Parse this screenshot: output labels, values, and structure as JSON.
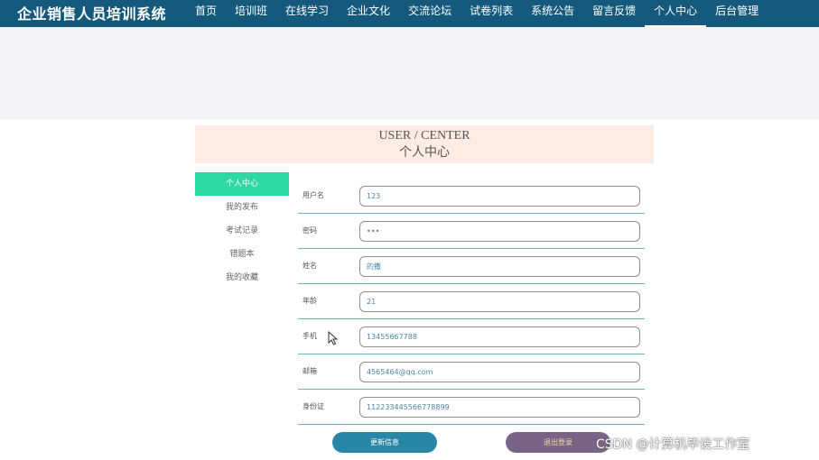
{
  "app": {
    "title": "企业销售人员培训系统"
  },
  "nav": {
    "items": [
      {
        "label": "首页"
      },
      {
        "label": "培训班"
      },
      {
        "label": "在线学习"
      },
      {
        "label": "企业文化"
      },
      {
        "label": "交流论坛"
      },
      {
        "label": "试卷列表"
      },
      {
        "label": "系统公告"
      },
      {
        "label": "留言反馈"
      },
      {
        "label": "个人中心"
      },
      {
        "label": "后台管理"
      }
    ],
    "active_index": 8
  },
  "header": {
    "title_en": "USER / CENTER",
    "title_cn": "个人中心"
  },
  "sidebar": {
    "items": [
      {
        "label": "个人中心"
      },
      {
        "label": "我的发布"
      },
      {
        "label": "考试记录"
      },
      {
        "label": "错题本"
      },
      {
        "label": "我的收藏"
      }
    ],
    "active_index": 0
  },
  "form": {
    "fields": [
      {
        "label": "用户名",
        "value": "123"
      },
      {
        "label": "密码",
        "value": "•••"
      },
      {
        "label": "姓名",
        "value": "的撒"
      },
      {
        "label": "年龄",
        "value": "21"
      },
      {
        "label": "手机",
        "value": "13455667788"
      },
      {
        "label": "邮箱",
        "value": "4565464@qq.com"
      },
      {
        "label": "身份证",
        "value": "112233445566778899"
      }
    ]
  },
  "actions": {
    "update_label": "更新信息",
    "logout_label": "退出登录"
  },
  "watermark": {
    "text": "CSDN @计算机毕设工作室"
  },
  "colors": {
    "topbar": "#155a7c",
    "sidebar_active": "#2ed8a2",
    "update_button": "#2a86a6",
    "logout_button": "#7b6388",
    "title_box": "#fdece3"
  }
}
